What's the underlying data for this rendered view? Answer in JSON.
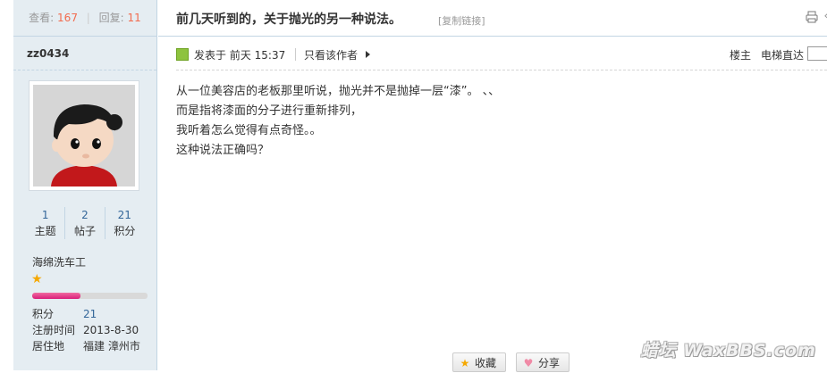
{
  "sidebar": {
    "view_label": "查看:",
    "view_count": "167",
    "reply_label": "回复:",
    "reply_count": "11",
    "author": "zz0434",
    "stats": [
      {
        "value": "1",
        "label": "主题"
      },
      {
        "value": "2",
        "label": "帖子"
      },
      {
        "value": "21",
        "label": "积分"
      }
    ],
    "user_group": "海绵洗车工",
    "level_progress": 0.42,
    "info": [
      {
        "label": "积分",
        "value": "21"
      },
      {
        "label": "注册时间",
        "value": "2013-8-30"
      },
      {
        "label": "居住地",
        "value": "福建 漳州市"
      }
    ]
  },
  "thread": {
    "title": "前几天听到的，关于抛光的另一种说法。",
    "copy_link": "[复制链接]"
  },
  "post": {
    "time": "发表于 前天 15:37",
    "only_author": "只看该作者",
    "floor": "楼主",
    "jump_label": "电梯直达",
    "lines": [
      "从一位美容店的老板那里听说，抛光并不是抛掉一层“漆”。  、、",
      "而是指将漆面的分子进行重新排列，",
      "我听着怎么觉得有点奇怪。。",
      "这种说法正确吗？"
    ],
    "favorite_label": "收藏",
    "share_label": "分享"
  },
  "watermark": "蜡坛 WaxBBS.com",
  "colors": {
    "sidebar_bg": "#e5edf2",
    "border": "#c2d5e3",
    "link": "#336699",
    "highlight": "#f26c4f",
    "level_pink": "#e83e8c"
  }
}
